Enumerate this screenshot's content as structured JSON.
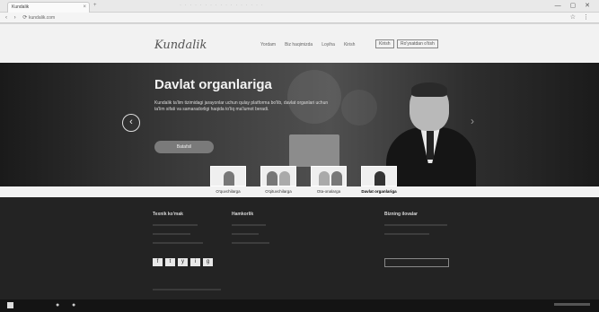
{
  "browser": {
    "tab_title": "Kundalik",
    "tab_close": "×",
    "new_tab": "+",
    "blurred_bar_text": "· · · · · · · · · · · · · · · · ·",
    "window_controls": "— ▢ ✕",
    "nav_buttons": "‹ › ⟳",
    "url": "kundalik.com",
    "extension_icons": "☆ ⋮"
  },
  "header": {
    "logo": "Kundalik",
    "nav": [
      "Yordam",
      "Biz haqimizda",
      "Loyiha",
      "Kirish"
    ],
    "login_label": "Kirish",
    "register_label": "Ro'yxatdan o'tish"
  },
  "hero": {
    "title": "Davlat organlariga",
    "text": "Kundalik ta'lim tizimidagi jarayonlar uchun qulay platforma bo'lib, davlat organlari uchun ta'lim sifati va samaradorligi haqida to'liq ma'lumot beradi.",
    "button_label": "Batafsil"
  },
  "categories": [
    {
      "label": "O'quvchilarga",
      "active": false
    },
    {
      "label": "O'qituvchilarga",
      "active": false
    },
    {
      "label": "Ota-onalarga",
      "active": false
    },
    {
      "label": "Davlat organlariga",
      "active": true
    }
  ],
  "footer": {
    "col1_title": "Texnik ko'mak",
    "col2_title": "Hamkorlik",
    "col3_title": "Bizning ilovalar",
    "social": [
      "f",
      "t",
      "y",
      "i",
      "g"
    ]
  },
  "colors": {
    "hero_bg": "#3a3a3a",
    "footer_bg": "#232323",
    "header_bg": "#f2f2f2"
  }
}
